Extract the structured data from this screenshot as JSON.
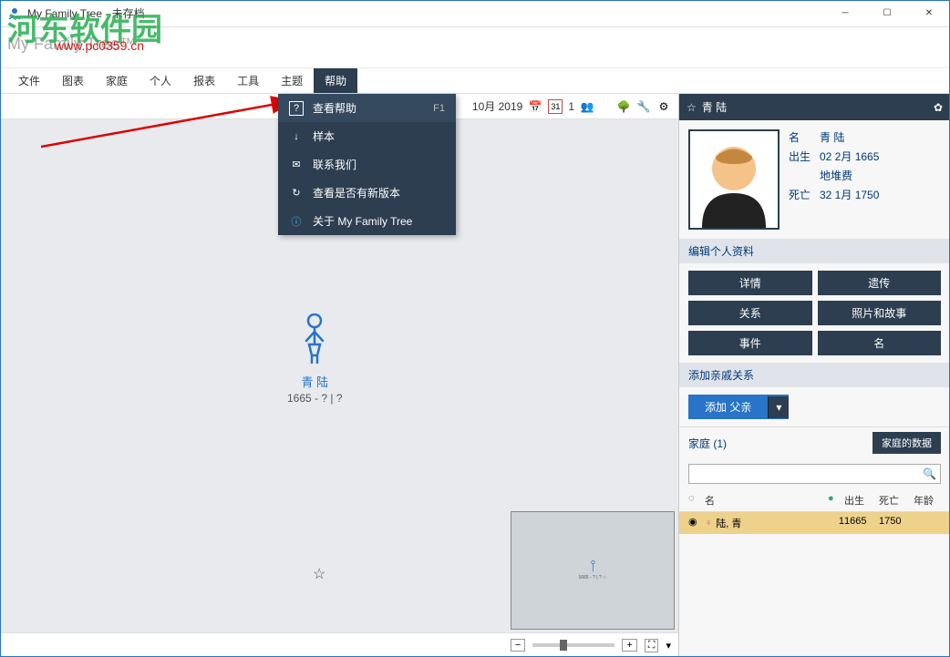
{
  "window": {
    "title": "My Family Tree - 未存档",
    "logo": "My Family Tree™"
  },
  "watermark": {
    "text": "河东软件园",
    "url": "www.pc0359.cn"
  },
  "menu": {
    "items": [
      "文件",
      "图表",
      "家庭",
      "个人",
      "报表",
      "工具",
      "主题",
      "帮助"
    ],
    "active": "帮助"
  },
  "dropdown": {
    "items": [
      {
        "icon": "?",
        "label": "查看帮助",
        "shortcut": "F1",
        "highlight": true
      },
      {
        "icon": "↓",
        "label": "样本",
        "shortcut": ""
      },
      {
        "icon": "✉",
        "label": "联系我们",
        "shortcut": ""
      },
      {
        "icon": "↻",
        "label": "查看是否有新版本",
        "shortcut": ""
      },
      {
        "icon": "ⓘ",
        "label": "关于 My Family Tree",
        "shortcut": ""
      }
    ]
  },
  "toolbar": {
    "date": "10月 2019",
    "day": "31",
    "count": "1"
  },
  "person_node": {
    "name": "青 陆",
    "sub": "1665 - ? | ?"
  },
  "sidepanel": {
    "title": "青 陆",
    "info": {
      "name_label": "名",
      "name_value": "青 陆",
      "birth_label": "出生",
      "birth_value": "02 2月 1665",
      "place_value": "地堆费",
      "death_label": "死亡",
      "death_value": "32 1月 1750"
    },
    "edit_section": "编辑个人资料",
    "buttons": [
      "详情",
      "遗传",
      "关系",
      "照片和故事",
      "事件",
      "名"
    ],
    "add_section": "添加亲戚关系",
    "add_button": "添加 父亲",
    "family_label": "家庭 (1)",
    "family_data_btn": "家庭的数据",
    "table_head": {
      "name": "名",
      "born": "出生",
      "died": "死亡",
      "age": "年龄"
    },
    "table_rows": [
      {
        "name": "陆, 青",
        "pin": "1",
        "born": "1665",
        "died": "1750",
        "age": ""
      }
    ]
  }
}
